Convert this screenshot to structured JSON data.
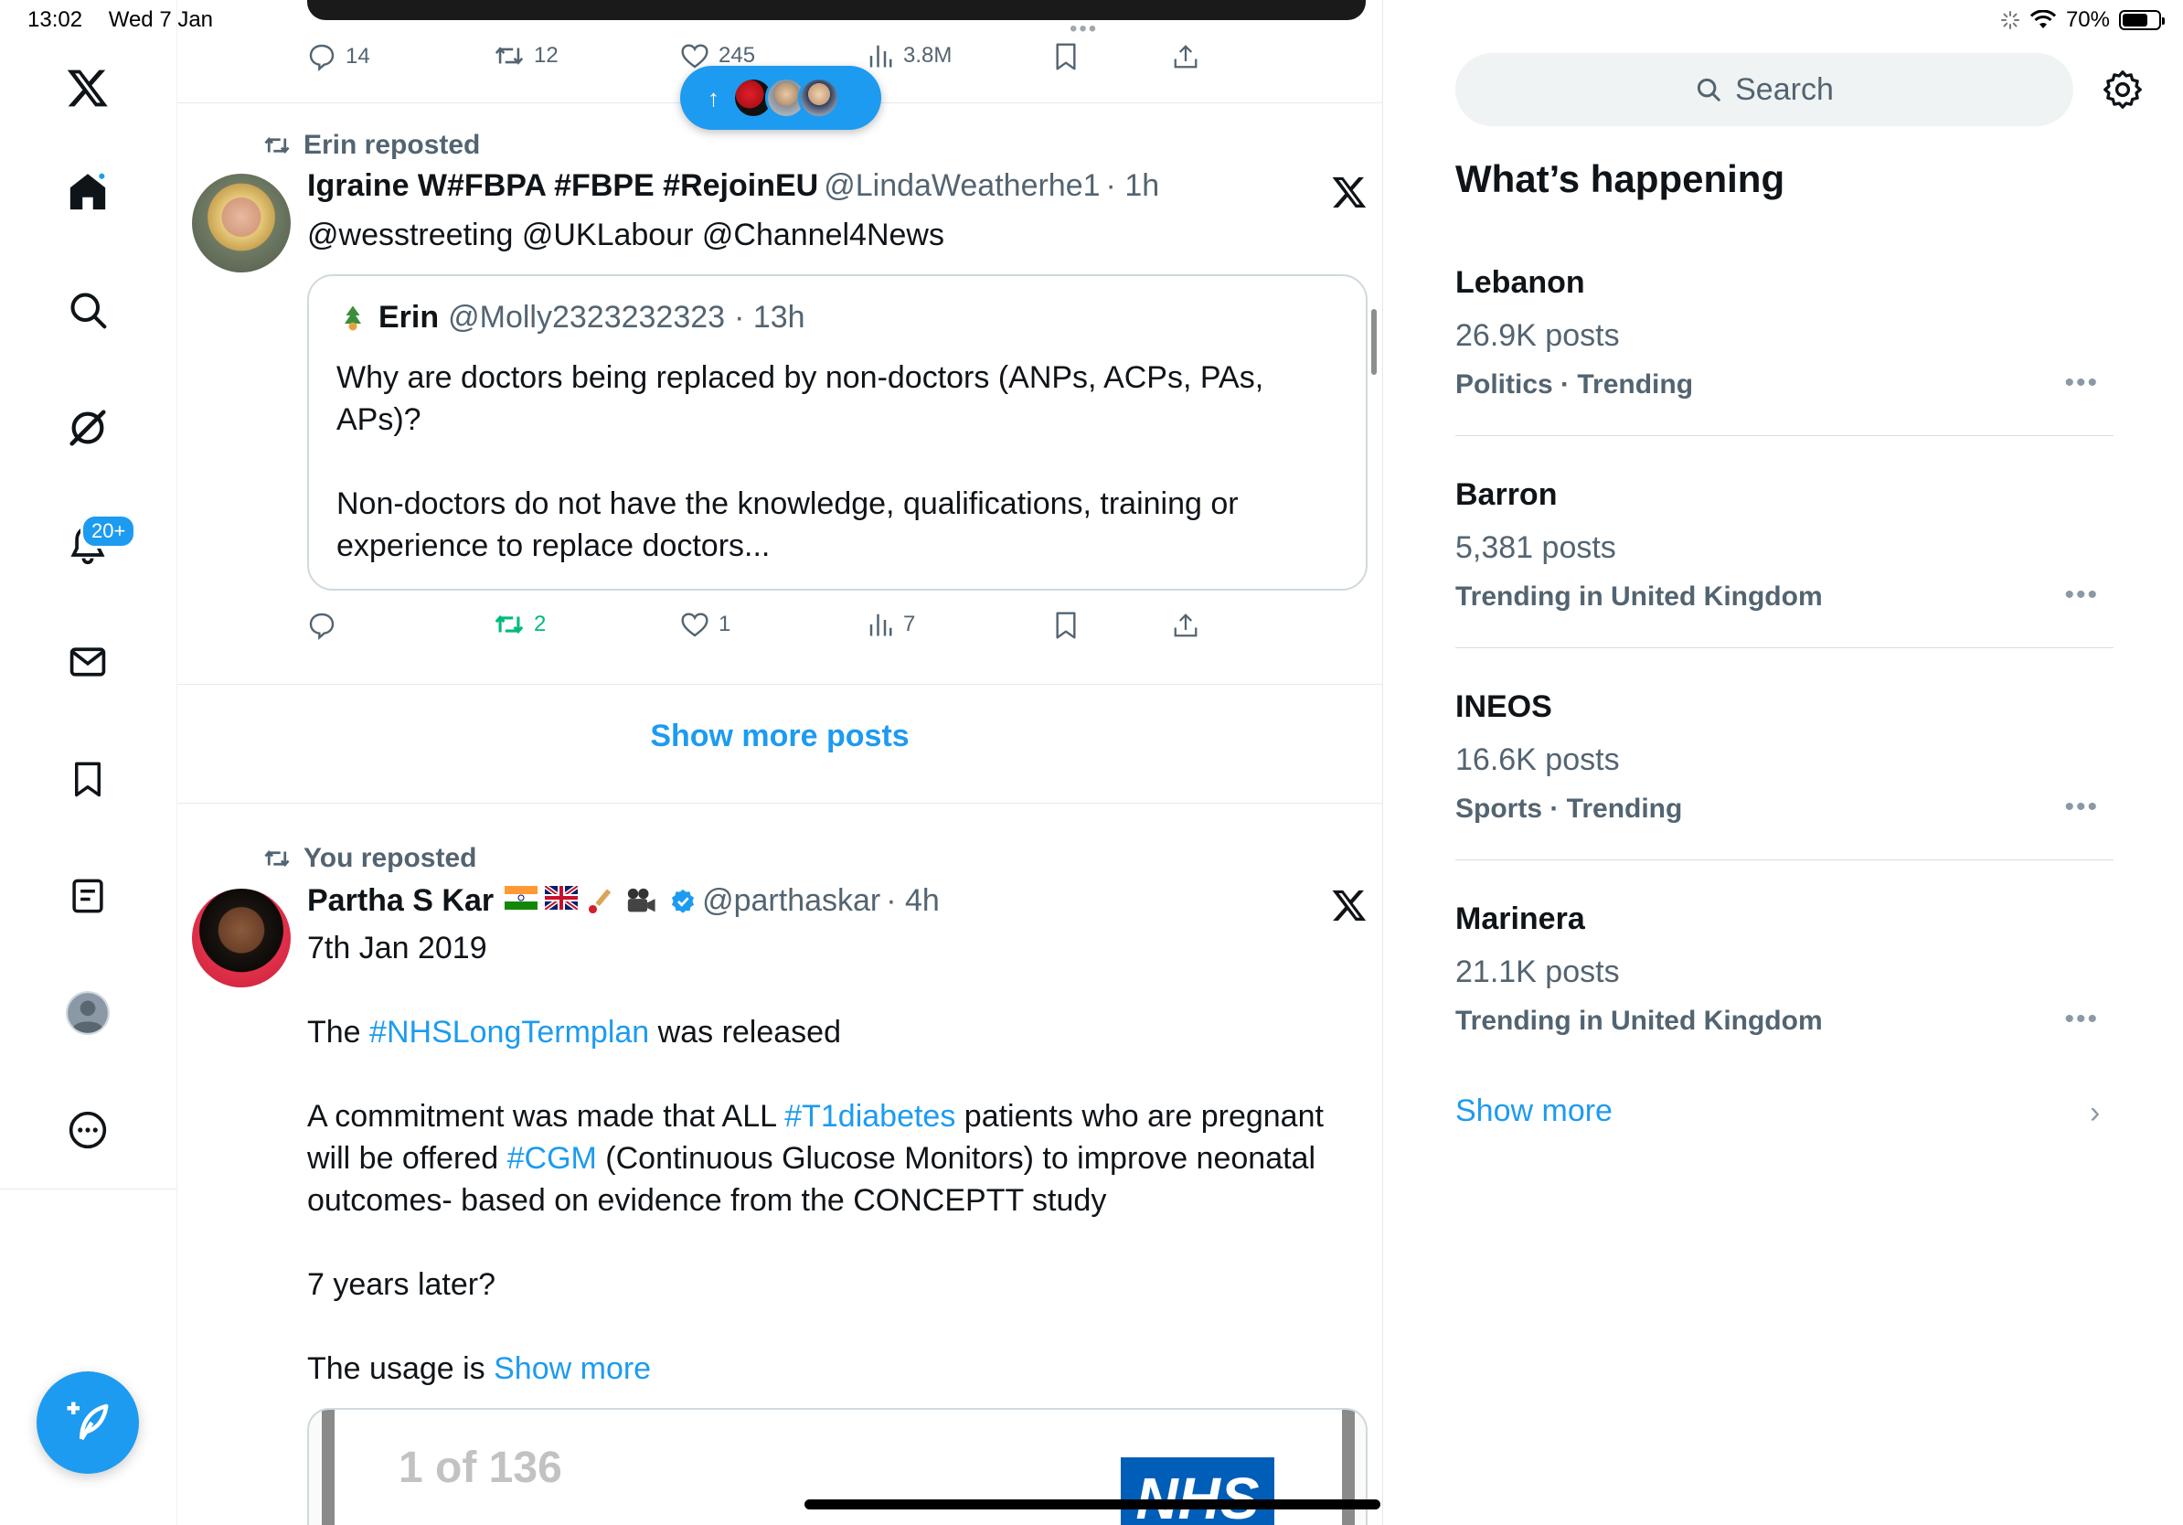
{
  "status_bar": {
    "time": "13:02",
    "date": "Wed 7 Jan",
    "battery": "70%",
    "battery_level": 0.7
  },
  "nav": {
    "notifications_badge": "20+"
  },
  "top_tweet_actions": {
    "replies": "14",
    "reposts": "12",
    "likes": "245",
    "views": "3.8M"
  },
  "tweet1": {
    "repost_label": "Erin reposted",
    "name": "Igraine W#FBPA #FBPE #RejoinEU",
    "handle": "@LindaWeatherhe1",
    "time": "· 1h",
    "mentions": "@wesstreeting @UKLabour @Channel4News",
    "quote": {
      "name": "Erin",
      "handle": "@Molly2323232323",
      "time": "· 13h",
      "text_1": "Why are doctors being replaced by non-doctors (ANPs, ACPs, PAs, APs)?",
      "text_2": "Non-doctors do not have the knowledge, qualifications, training or experience to replace  doctors..."
    },
    "actions": {
      "replies": "",
      "reposts": "2",
      "likes": "1",
      "views": "7"
    }
  },
  "show_more_posts": "Show more posts",
  "tweet2": {
    "repost_label": "You reposted",
    "name": "Partha S Kar",
    "handle": "@parthaskar",
    "time": "· 4h",
    "line_date": "7th Jan 2019",
    "p1_a": "The ",
    "p1_tag": "#NHSLongTermplan",
    "p1_b": " was released",
    "p2_a": "A commitment was made that ALL ",
    "p2_tag1": "#T1diabetes",
    "p2_b": " patients who are pregnant will be offered ",
    "p2_tag2": "#CGM",
    "p2_c": " (Continuous Glucose Monitors) to improve neonatal outcomes- based on evidence from the CONCEPTT study",
    "p3": "7 years later?",
    "p4_a": "The usage is ",
    "p4_link": "Show more",
    "image_page": "1 of 136",
    "image_logo": "NHS"
  },
  "right": {
    "search_placeholder": "Search",
    "section_title": "What’s happening",
    "trends": [
      {
        "name": "Lebanon",
        "count": "26.9K posts",
        "meta": "Politics · Trending"
      },
      {
        "name": "Barron",
        "count": "5,381 posts",
        "meta": "Trending in United Kingdom"
      },
      {
        "name": "INEOS",
        "count": "16.6K posts",
        "meta": "Sports · Trending"
      },
      {
        "name": "Marinera",
        "count": "21.1K posts",
        "meta": "Trending in United Kingdom"
      }
    ],
    "show_more": "Show more"
  },
  "colors": {
    "accent": "#1d9bf0",
    "repost_green": "#00ba7c",
    "text": "#0f1419",
    "muted": "#536471"
  }
}
